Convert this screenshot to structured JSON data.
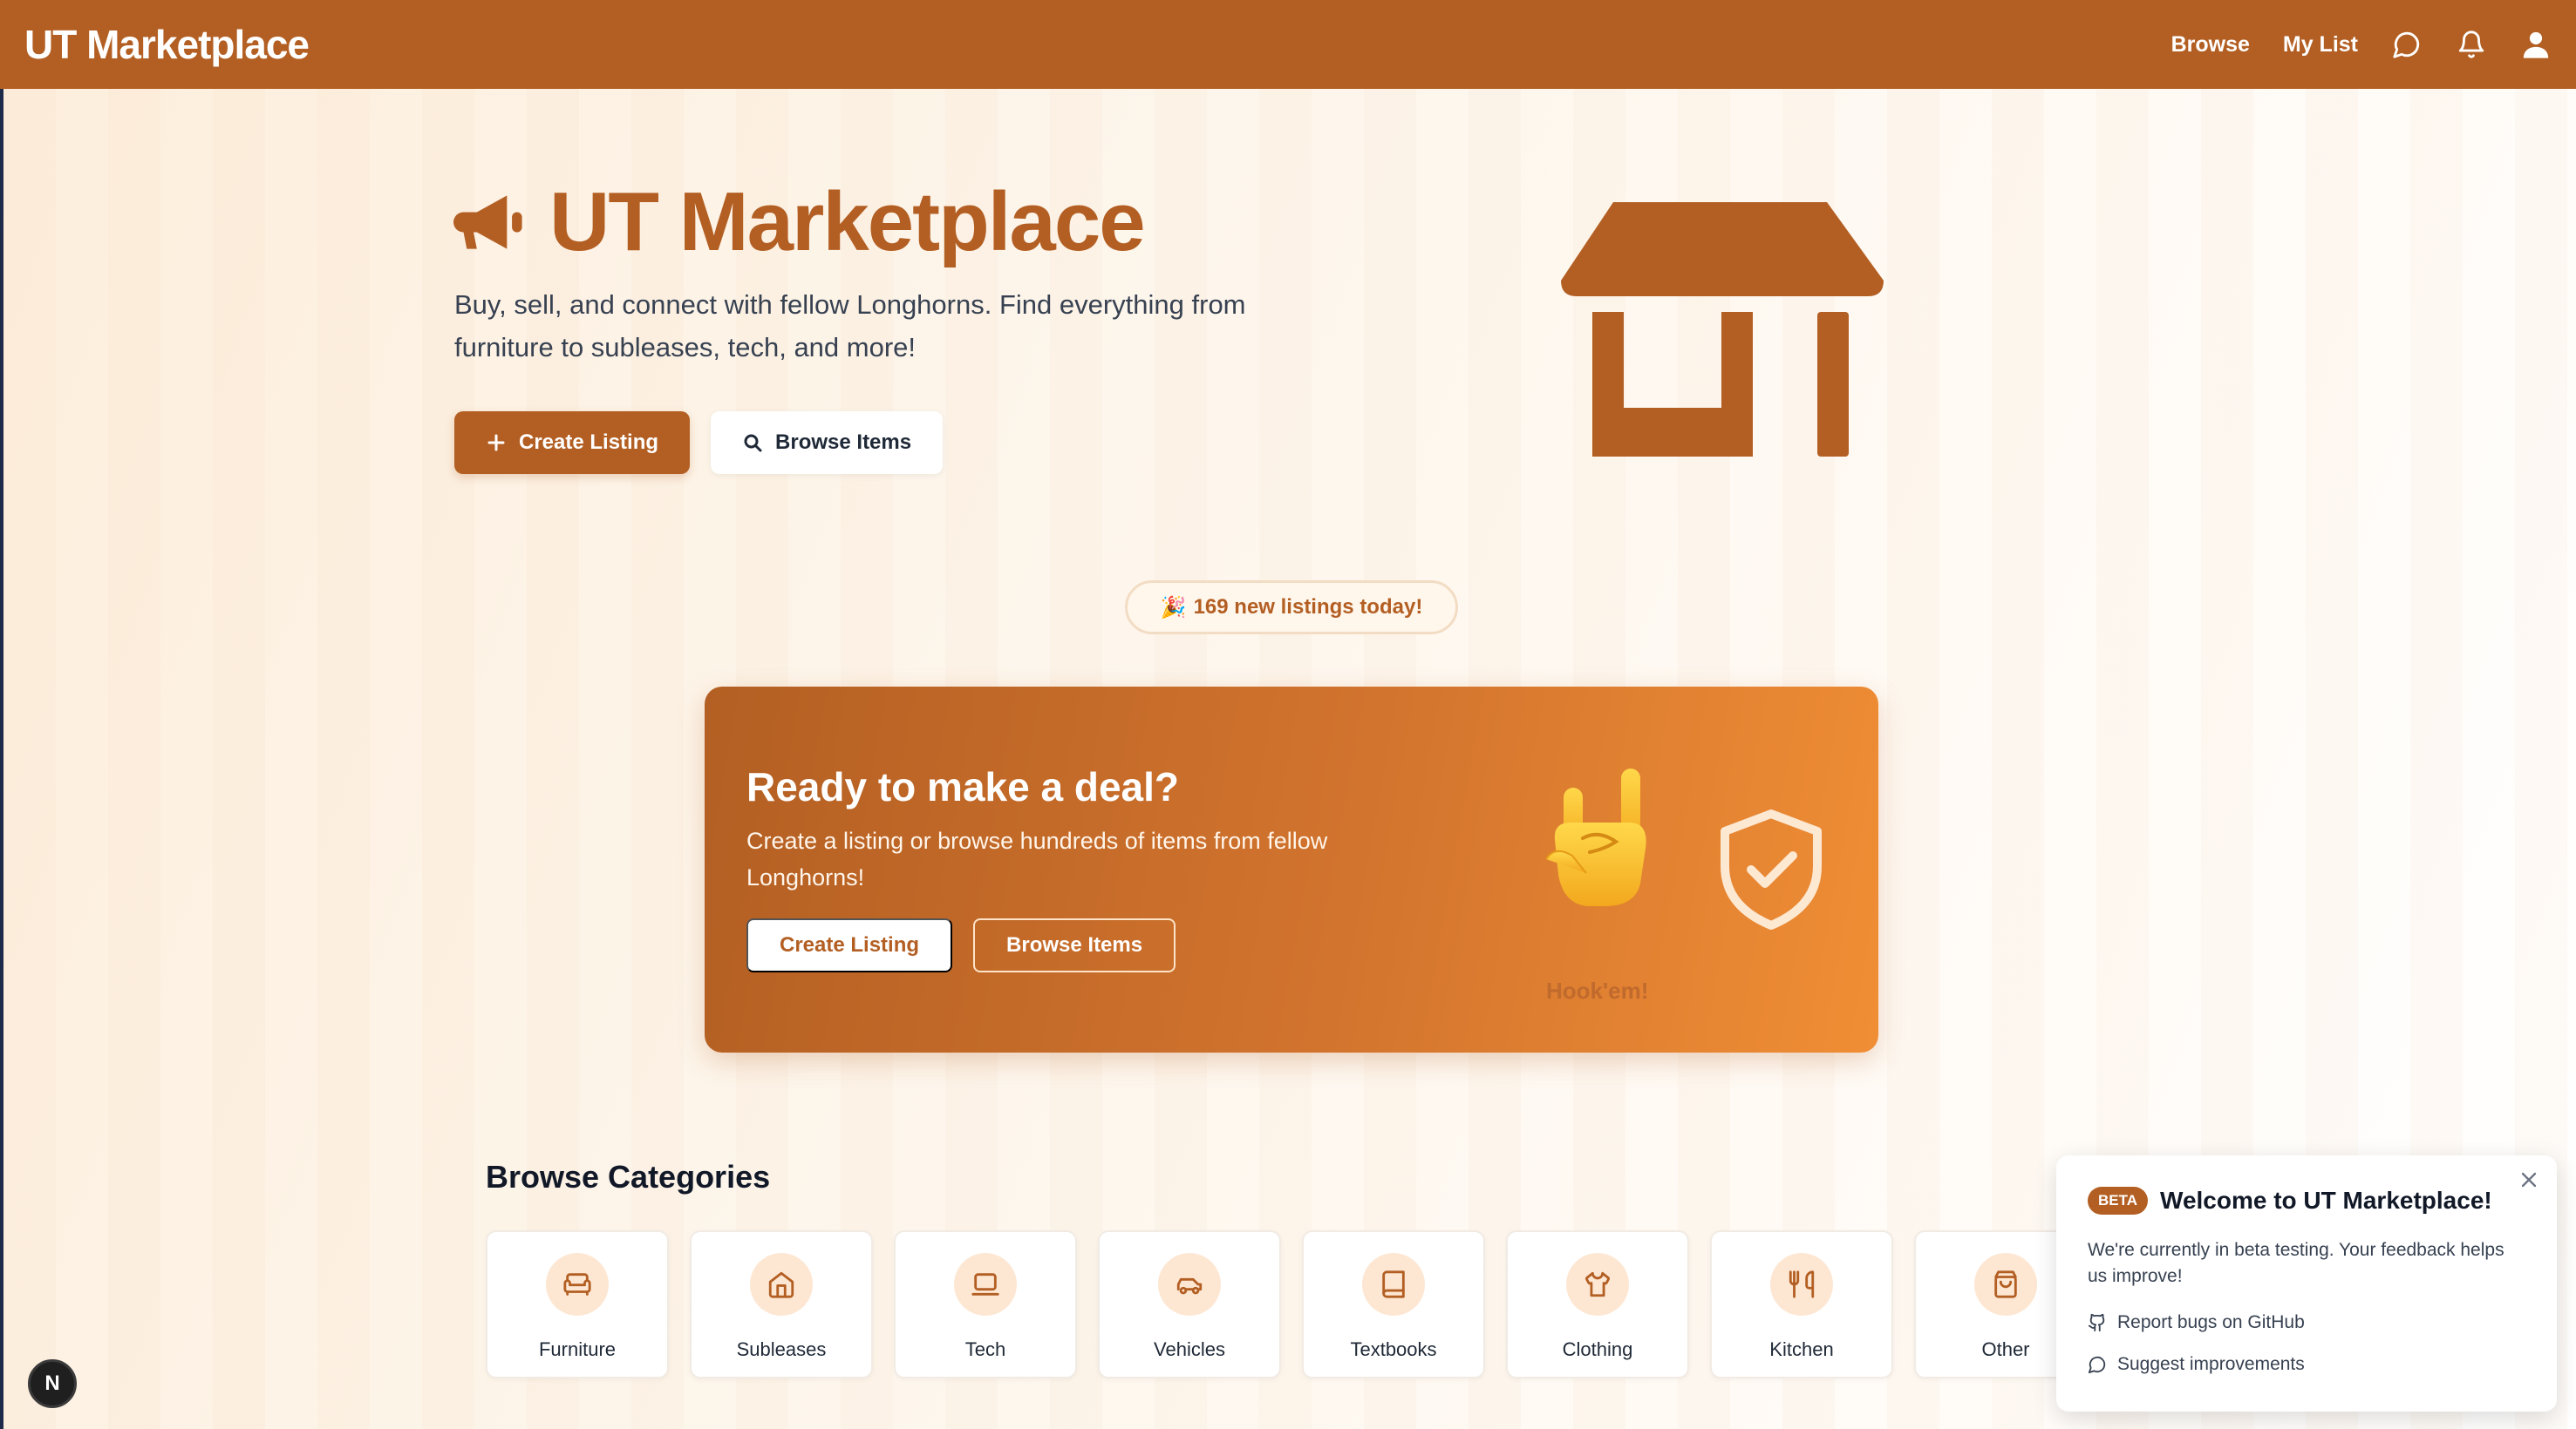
{
  "nav": {
    "brand": "UT Marketplace",
    "links": [
      "Browse",
      "My List"
    ],
    "icons": [
      "chat-icon",
      "bell-icon",
      "user-icon"
    ],
    "bar_color": "#b35f23"
  },
  "hero": {
    "title": "UT Marketplace",
    "subtitle": "Buy, sell, and connect with fellow Longhorns. Find everything from furniture to subleases, tech, and more!",
    "create_label": "Create Listing",
    "browse_label": "Browse Items"
  },
  "badge": {
    "emoji": "🎉",
    "text": "169 new listings today!"
  },
  "deal": {
    "title": "Ready to make a deal?",
    "text": "Create a listing or browse hundreds of items from fellow Longhorns!",
    "create_label": "Create Listing",
    "browse_label": "Browse Items",
    "hookem": "Hook'em!"
  },
  "categories": {
    "heading": "Browse Categories",
    "items": [
      {
        "label": "Furniture",
        "icon": "sofa-icon"
      },
      {
        "label": "Subleases",
        "icon": "house-icon"
      },
      {
        "label": "Tech",
        "icon": "laptop-icon"
      },
      {
        "label": "Vehicles",
        "icon": "car-icon"
      },
      {
        "label": "Textbooks",
        "icon": "book-icon"
      },
      {
        "label": "Clothing",
        "icon": "shirt-icon"
      },
      {
        "label": "Kitchen",
        "icon": "utensils-icon"
      },
      {
        "label": "Other",
        "icon": "bag-icon"
      }
    ]
  },
  "beta": {
    "badge": "BETA",
    "title": "Welcome to UT Marketplace!",
    "text": "We're currently in beta testing. Your feedback helps us improve!",
    "report_label": "Report bugs on GitHub",
    "suggest_label": "Suggest improvements"
  },
  "next_badge": "N",
  "colors": {
    "accent": "#b35f23",
    "accent_light": "#fde7d3"
  }
}
